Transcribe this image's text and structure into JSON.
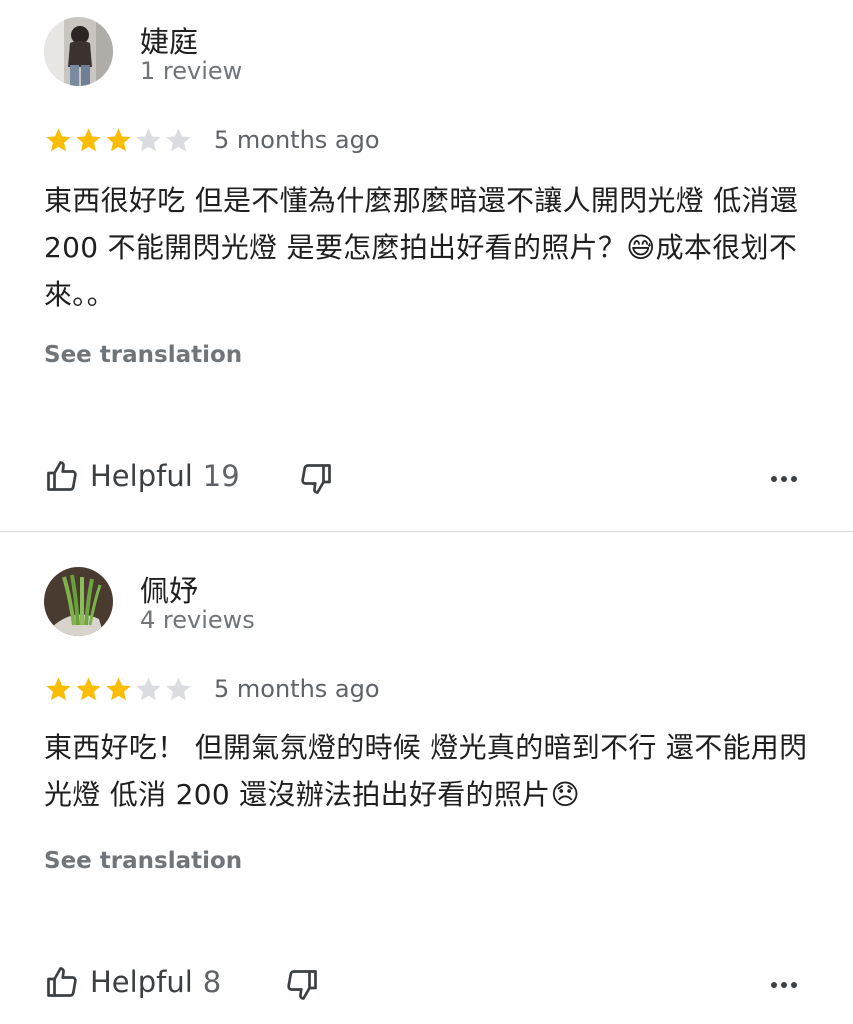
{
  "reviews": [
    {
      "author": "婕庭",
      "review_count": "1 review",
      "rating": 3,
      "max_rating": 5,
      "time": "5 months ago",
      "text": "東西很好吃 但是不懂為什麼那麼暗還不讓人開閃光燈 低消還 200 不能開閃光燈 是要怎麼拍出好看的照片？😅成本很划不來。。",
      "see_translation": "See translation",
      "helpful_label": "Helpful",
      "helpful_count": "19"
    },
    {
      "author": "佩妤",
      "review_count": "4 reviews",
      "rating": 3,
      "max_rating": 5,
      "time": "5 months ago",
      "text": "東西好吃！ 但開氣氛燈的時候 燈光真的暗到不行 還不能用閃光燈 低消 200 還沒辦法拍出好看的照片😞",
      "see_translation": "See translation",
      "helpful_label": "Helpful",
      "helpful_count": "8"
    }
  ],
  "colors": {
    "star_filled": "#fbbc04",
    "star_empty": "#dadce0",
    "secondary_text": "#70757a",
    "divider": "#dadce0"
  },
  "icons": {
    "thumb_up": "thumb-up-icon",
    "thumb_down": "thumb-down-icon",
    "more": "more-horizontal-icon"
  }
}
